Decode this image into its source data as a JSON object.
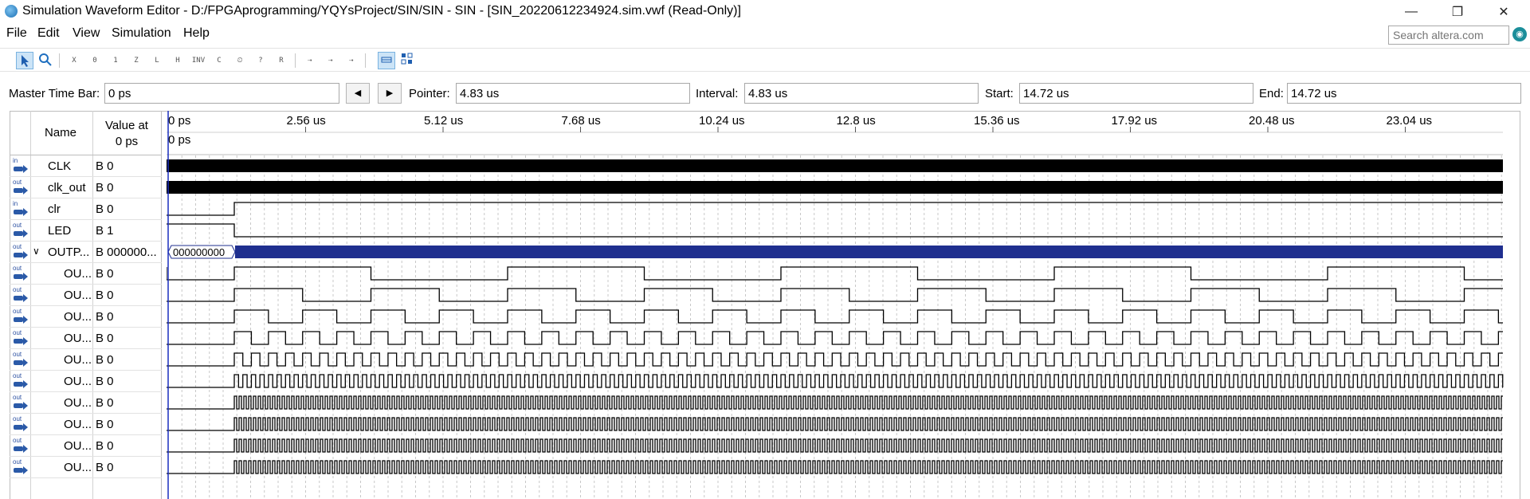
{
  "window": {
    "title": "Simulation Waveform Editor - D:/FPGAprogramming/YQYsProject/SIN/SIN - SIN - [SIN_20220612234924.sim.vwf (Read-Only)]",
    "minimize": "—",
    "restore": "❐",
    "close": "✕"
  },
  "menu": [
    "File",
    "Edit",
    "View",
    "Simulation",
    "Help"
  ],
  "search": {
    "placeholder": "Search altera.com"
  },
  "toolbar": {
    "icons": [
      "selection-tool-icon",
      "zoom-tool-icon",
      "unknown-value-icon",
      "force-low-icon",
      "force-high-icon",
      "high-impedance-icon",
      "weak-low-icon",
      "weak-high-icon",
      "invert-icon",
      "count-value-icon",
      "clock-value-icon",
      "arbitrary-value-icon",
      "random-value-icon",
      "functional-sim-icon",
      "timing-sim-icon",
      "netlist-sim-icon",
      "snap-to-grid-icon",
      "grid-settings-icon"
    ]
  },
  "timebar": {
    "master_label": "Master Time Bar:",
    "master_value": "0 ps",
    "prev": "◀",
    "next": "▶",
    "pointer_label": "Pointer:",
    "pointer_value": "4.83 us",
    "interval_label": "Interval:",
    "interval_value": "4.83 us",
    "start_label": "Start:",
    "start_value": "14.72 us",
    "end_label": "End:",
    "end_value": "14.72 us"
  },
  "header": {
    "name": "Name",
    "value_at_line1": "Value at",
    "value_at_line2": "0 ps"
  },
  "ruler": {
    "ticks": [
      "0 ps",
      "2.56 us",
      "5.12 us",
      "7.68 us",
      "10.24 us",
      "12.8 us",
      "15.36 us",
      "17.92 us",
      "20.48 us",
      "23.04 us"
    ],
    "cursor_label": "0 ps"
  },
  "signals": [
    {
      "dir": "in",
      "name": "CLK",
      "value": "B 0"
    },
    {
      "dir": "out",
      "name": "clk_out",
      "value": "B 0"
    },
    {
      "dir": "in",
      "name": "clr",
      "value": "B 0"
    },
    {
      "dir": "out",
      "name": "LED",
      "value": "B 1"
    },
    {
      "dir": "out",
      "name": "OUTP...",
      "value": "B 000000...",
      "bus_label": "000000000"
    },
    {
      "dir": "out",
      "name": "OU...",
      "value": "B 0"
    },
    {
      "dir": "out",
      "name": "OU...",
      "value": "B 0"
    },
    {
      "dir": "out",
      "name": "OU...",
      "value": "B 0"
    },
    {
      "dir": "out",
      "name": "OU...",
      "value": "B 0"
    },
    {
      "dir": "out",
      "name": "OU...",
      "value": "B 0"
    },
    {
      "dir": "out",
      "name": "OU...",
      "value": "B 0"
    },
    {
      "dir": "out",
      "name": "OU...",
      "value": "B 0"
    },
    {
      "dir": "out",
      "name": "OU...",
      "value": "B 0"
    },
    {
      "dir": "out",
      "name": "OU...",
      "value": "B 0"
    },
    {
      "dir": "out",
      "name": "OU...",
      "value": "B 0"
    }
  ],
  "colors": {
    "wave": "#000000",
    "bus": "#1f2f8f",
    "cursor": "#1a2fbf",
    "grid": "#c8c8c8"
  }
}
